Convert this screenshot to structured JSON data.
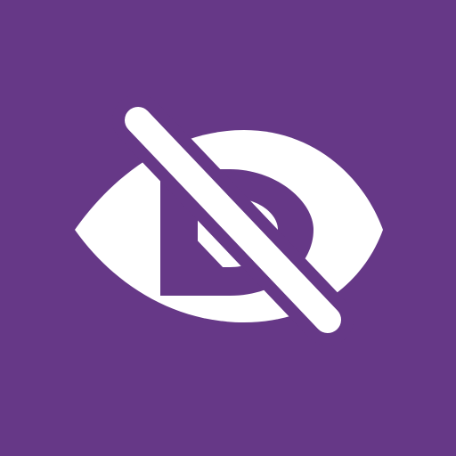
{
  "icon": {
    "name": "eye-slash-icon",
    "background_color": "#663887",
    "foreground_color": "#FFFFFF"
  }
}
